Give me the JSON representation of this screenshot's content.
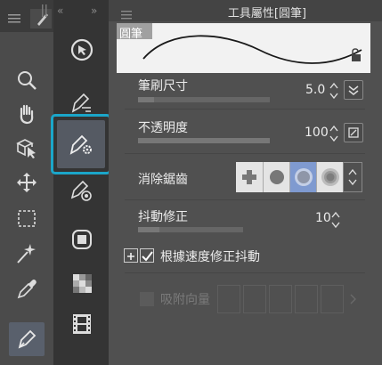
{
  "panel": {
    "title": "工具屬性[圓筆]",
    "preview_label": "圓筆"
  },
  "props": {
    "brush_size": {
      "label": "筆刷尺寸",
      "value": "5.0",
      "level": 0.12
    },
    "opacity": {
      "label": "不透明度",
      "value": "100",
      "level": 1.0
    },
    "antialias": {
      "label": "消除鋸齒",
      "selected_index": 2
    },
    "stabilization": {
      "label": "抖動修正",
      "value": "10",
      "level": 0.2
    },
    "speed_stabilization": {
      "label": "根據速度修正抖動",
      "checked": true
    },
    "vector_snap": {
      "label": "吸附向量",
      "checked": false
    }
  },
  "icons": {
    "left_tools": [
      "zoom-icon",
      "hand-icon",
      "operation-icon",
      "move-icon",
      "selection-icon",
      "auto-select-icon",
      "eyedropper-icon",
      "pen-icon"
    ],
    "sub_tools": [
      "operation-sub-icon",
      "pen-sub-icon",
      "pen-gear-icon",
      "pen-circle-icon",
      "fill-icon",
      "gradient-icon",
      "film-icon"
    ]
  },
  "colors": {
    "highlight": "#1ba6c9",
    "selected_tool_bg": "#59606c"
  }
}
